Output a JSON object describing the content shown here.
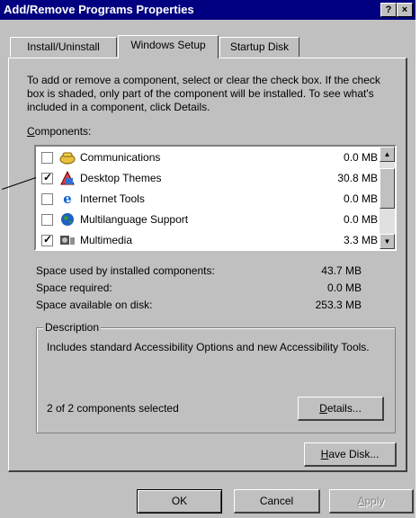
{
  "window": {
    "title": "Add/Remove Programs Properties",
    "help_btn": "?",
    "close_btn": "×"
  },
  "tabs": [
    {
      "label": "Install/Uninstall",
      "active": false
    },
    {
      "label": "Windows Setup",
      "active": true
    },
    {
      "label": "Startup Disk",
      "active": false
    }
  ],
  "intro_text": "To add or remove a component, select or clear the check box. If the check box is shaded, only part of the component will be installed. To see what's included in a component, click Details.",
  "components_label": {
    "first": "C",
    "rest": "omponents:"
  },
  "components": [
    {
      "name": "Communications",
      "size": "0.0 MB",
      "checked": false,
      "icon": "phone-icon"
    },
    {
      "name": "Desktop Themes",
      "size": "30.8 MB",
      "checked": true,
      "icon": "themes-icon"
    },
    {
      "name": "Internet Tools",
      "size": "0.0 MB",
      "checked": false,
      "icon": "ie-icon"
    },
    {
      "name": "Multilanguage Support",
      "size": "0.0 MB",
      "checked": false,
      "icon": "globe-icon"
    },
    {
      "name": "Multimedia",
      "size": "3.3 MB",
      "checked": true,
      "icon": "multimedia-icon"
    }
  ],
  "space": {
    "used_label": "Space used by installed components:",
    "used_value": "43.7 MB",
    "required_label": "Space required:",
    "required_value": "0.0 MB",
    "available_label": "Space available on disk:",
    "available_value": "253.3 MB"
  },
  "description": {
    "title": "Description",
    "text": "Includes standard Accessibility Options and new Accessibility Tools.",
    "selected": "2 of 2 components selected"
  },
  "buttons": {
    "details": {
      "first": "D",
      "rest": "etails..."
    },
    "have_disk": {
      "first": "H",
      "rest": "ave Disk..."
    },
    "ok": "OK",
    "cancel": "Cancel",
    "apply": {
      "first": "A",
      "rest": "pply"
    }
  }
}
